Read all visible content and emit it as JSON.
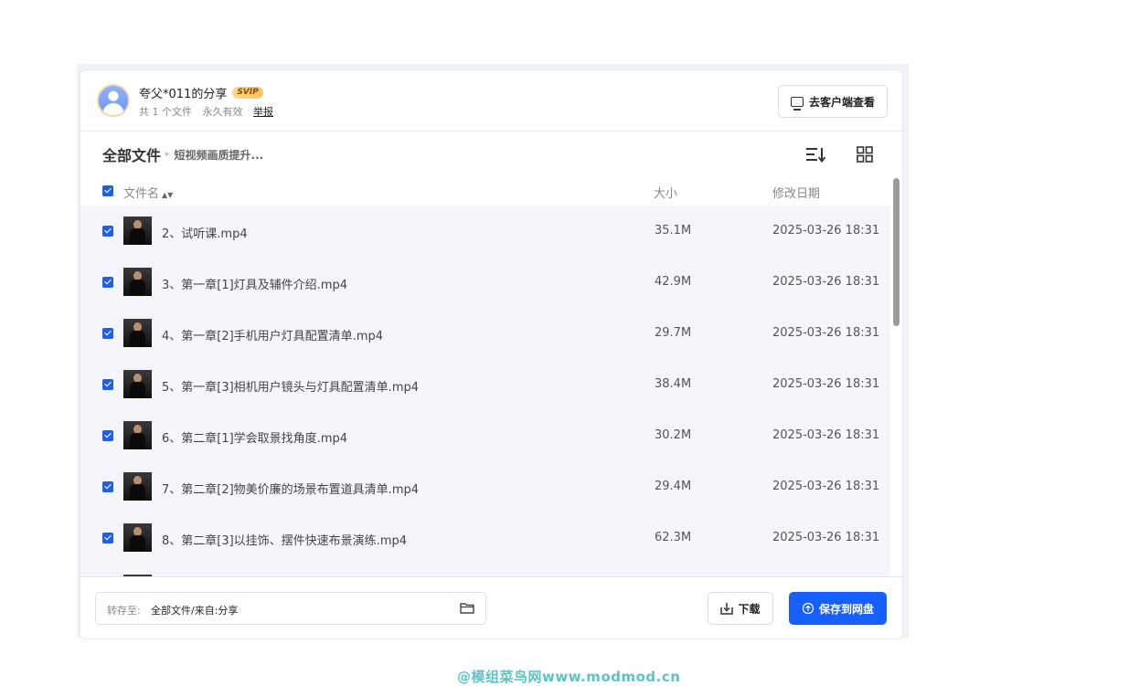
{
  "header": {
    "sharer": "夸父*011的分享",
    "vip_badge": "SVIP",
    "file_count": "共 1 个文件",
    "validity": "永久有效",
    "report": "举报",
    "client_button": "去客户端查看"
  },
  "breadcrumb": {
    "root": "全部文件",
    "current": "短视频画质提升..."
  },
  "columns": {
    "name": "文件名",
    "size": "大小",
    "date": "修改日期"
  },
  "files": [
    {
      "name": "2、试听课.mp4",
      "size": "35.1M",
      "date": "2025-03-26 18:31"
    },
    {
      "name": "3、第一章[1]灯具及辅件介绍.mp4",
      "size": "42.9M",
      "date": "2025-03-26 18:31"
    },
    {
      "name": "4、第一章[2]手机用户灯具配置清单.mp4",
      "size": "29.7M",
      "date": "2025-03-26 18:31"
    },
    {
      "name": "5、第一章[3]相机用户镜头与灯具配置清单.mp4",
      "size": "38.4M",
      "date": "2025-03-26 18:31"
    },
    {
      "name": "6、第二章[1]学会取景找角度.mp4",
      "size": "30.2M",
      "date": "2025-03-26 18:31"
    },
    {
      "name": "7、第二章[2]物美价廉的场景布置道具清单.mp4",
      "size": "29.4M",
      "date": "2025-03-26 18:31"
    },
    {
      "name": "8、第二章[3]以挂饰、摆件快速布景演练.mp4",
      "size": "62.3M",
      "date": "2025-03-26 18:31"
    }
  ],
  "footer": {
    "dest_label": "转存至:",
    "dest_value": "全部文件/来自:分享",
    "download": "下载",
    "save": "保存到网盘"
  },
  "watermark": "@模组菜鸟网www.modmod.cn",
  "colors": {
    "accent": "#1660ff",
    "checkbox": "#1f5fe6",
    "row_bg": "#f4f6fb"
  }
}
